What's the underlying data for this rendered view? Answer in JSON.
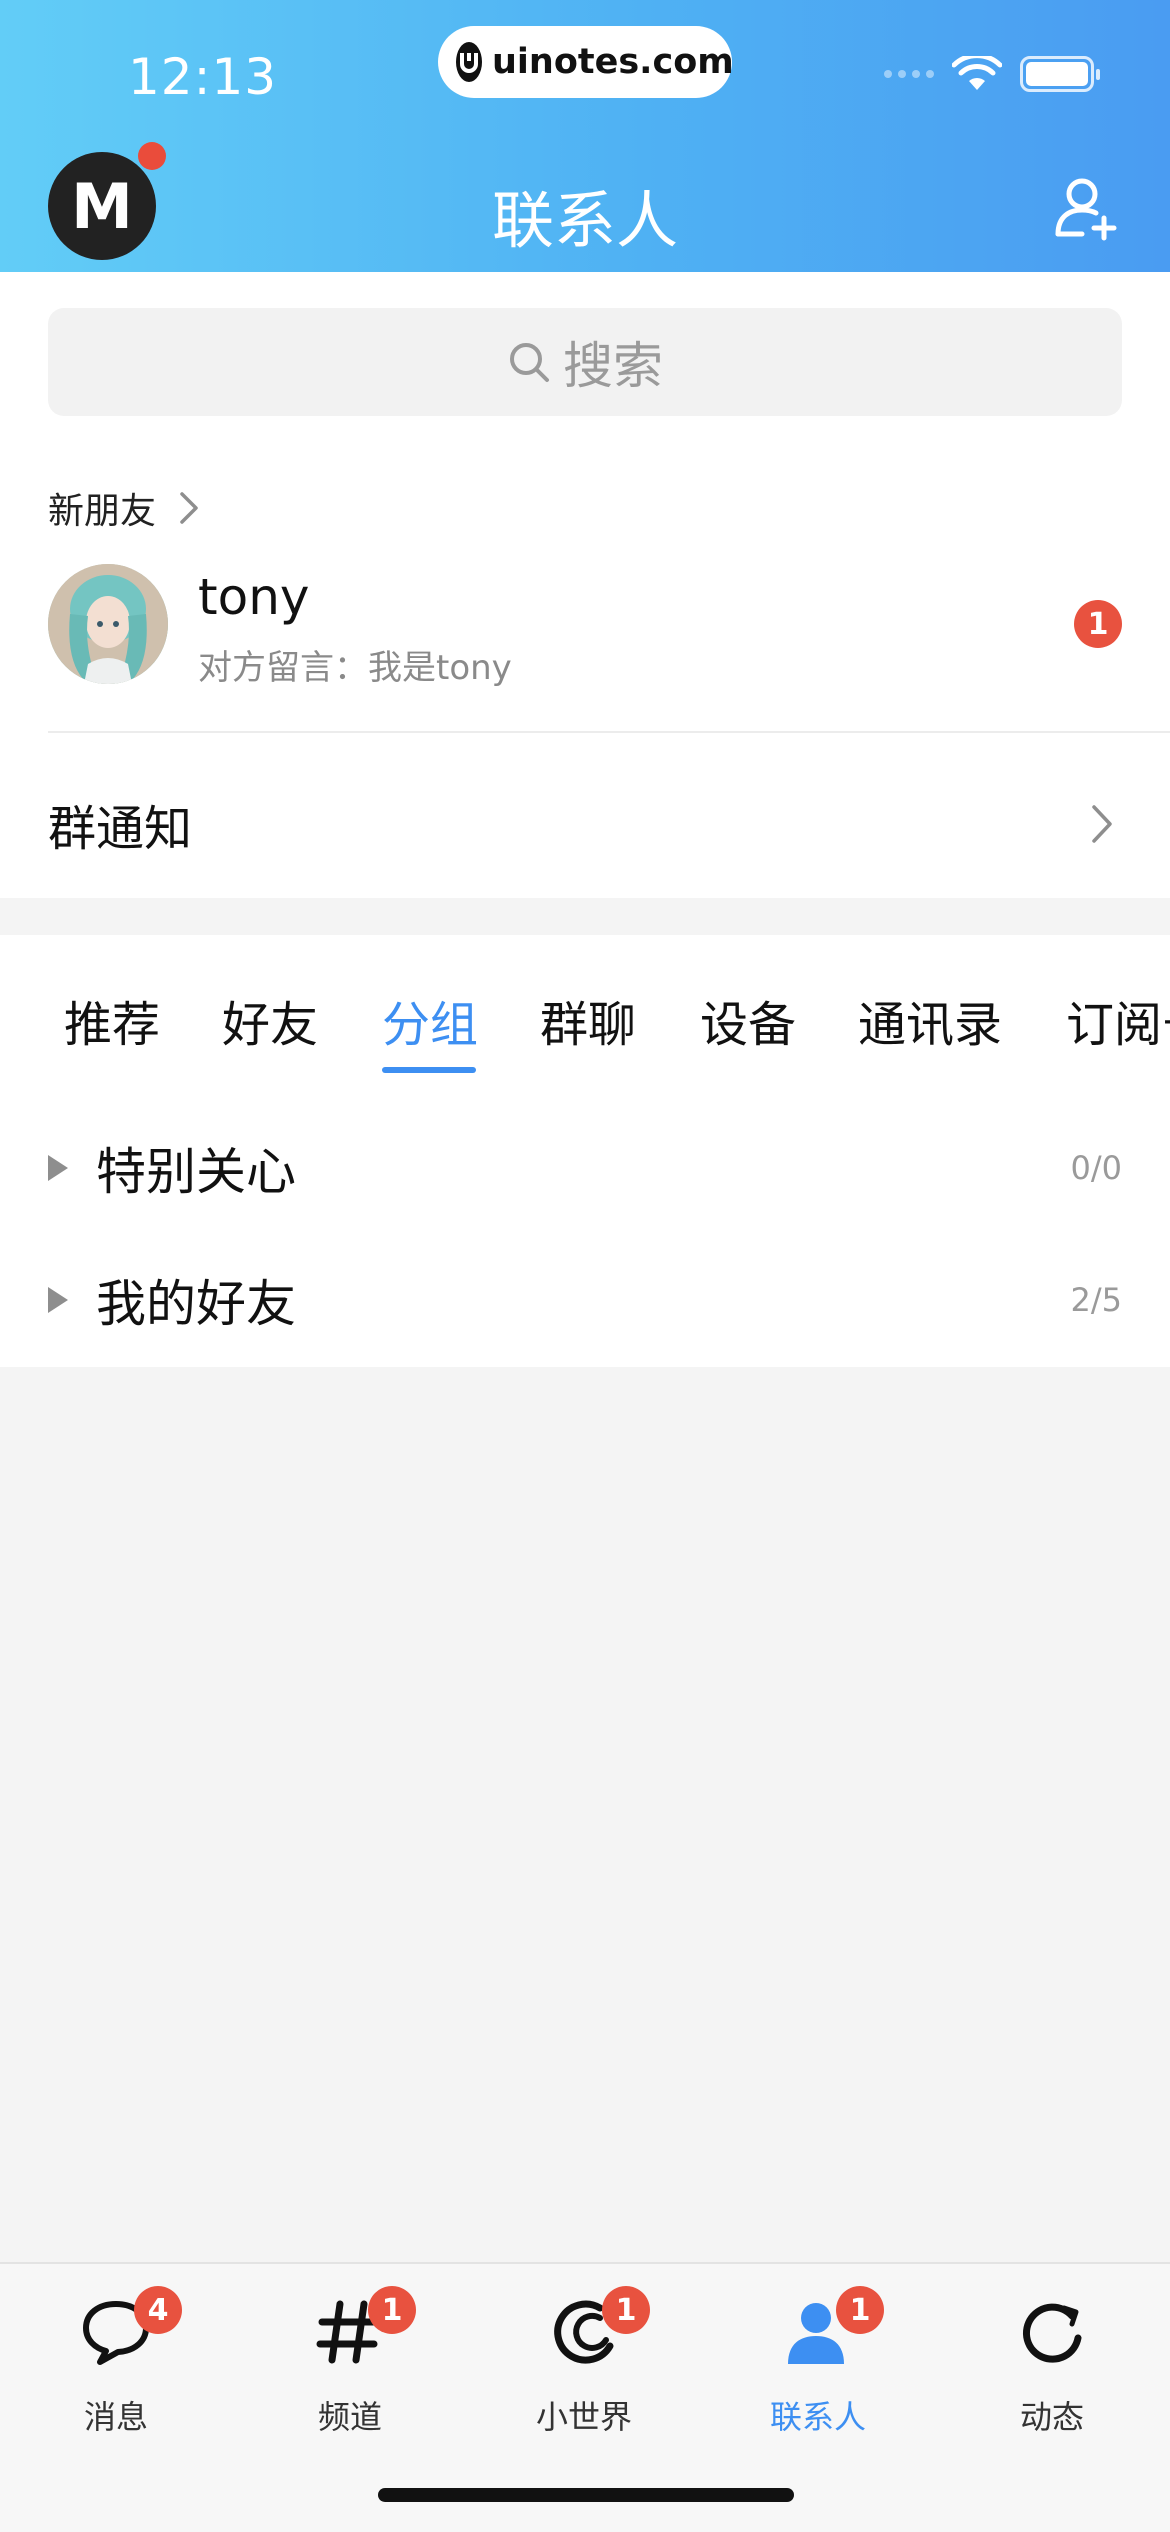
{
  "status_bar": {
    "time": "12:13",
    "url": "uinotes.com"
  },
  "header": {
    "title": "联系人",
    "avatar_letter": "M"
  },
  "search": {
    "placeholder": "搜索"
  },
  "new_friends": {
    "label": "新朋友",
    "friend": {
      "name": "tony",
      "message": "对方留言：我是tony",
      "badge": "1"
    }
  },
  "group_notice": {
    "label": "群通知"
  },
  "tabs": [
    {
      "label": "推荐"
    },
    {
      "label": "好友"
    },
    {
      "label": "分组",
      "active": true
    },
    {
      "label": "群聊"
    },
    {
      "label": "设备"
    },
    {
      "label": "通讯录"
    },
    {
      "label": "订阅号"
    }
  ],
  "groups": [
    {
      "label": "特别关心",
      "count": "0/0"
    },
    {
      "label": "我的好友",
      "count": "2/5"
    }
  ],
  "bottom_nav": [
    {
      "label": "消息",
      "icon": "chat-bubble-icon",
      "badge": "4"
    },
    {
      "label": "频道",
      "icon": "hashtag-icon",
      "badge": "1"
    },
    {
      "label": "小世界",
      "icon": "moon-icon",
      "badge": "1"
    },
    {
      "label": "联系人",
      "icon": "contacts-person-icon",
      "badge": "1",
      "active": true
    },
    {
      "label": "动态",
      "icon": "refresh-star-icon"
    }
  ],
  "colors": {
    "accent": "#3d8ff2",
    "badge": "#e8523f",
    "header_start": "#62cdf7",
    "header_end": "#4a9cf2"
  }
}
